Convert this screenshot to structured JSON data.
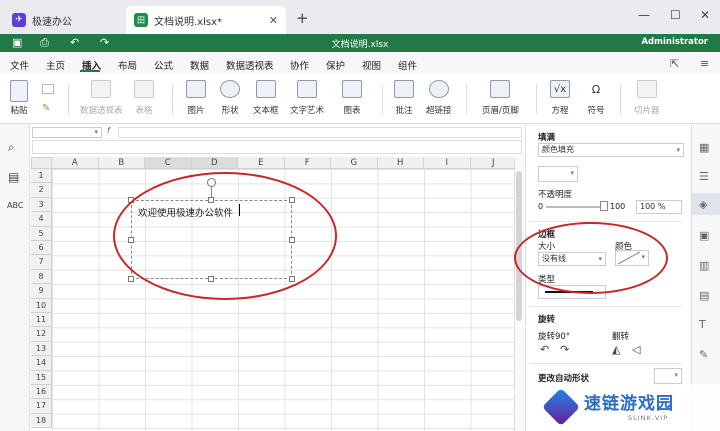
{
  "tabs": [
    {
      "label": "极速办公"
    },
    {
      "label": "文档说明.xlsx*"
    }
  ],
  "titlebar": {
    "title": "文档说明.xlsx",
    "user": "Administrator"
  },
  "menu": [
    "文件",
    "主页",
    "插入",
    "布局",
    "公式",
    "数据",
    "数据透视表",
    "协作",
    "保护",
    "视图",
    "组件"
  ],
  "ribbon": {
    "paste": "粘贴",
    "pivot": "数据透视表",
    "table": "表格",
    "image": "图片",
    "shape": "形状",
    "textbox": "文本框",
    "textart": "文字艺术",
    "chart": "图表",
    "comment": "批注",
    "hyperlink": "超链接",
    "header_footer": "页眉/页脚",
    "equation": "方程",
    "symbol": "符号",
    "slicer": "切片器"
  },
  "columns": [
    "A",
    "B",
    "C",
    "D",
    "E",
    "F",
    "G",
    "H",
    "I",
    "J"
  ],
  "rows": [
    "1",
    "2",
    "3",
    "4",
    "5",
    "6",
    "7",
    "8",
    "9",
    "10",
    "11",
    "12",
    "13",
    "14",
    "15",
    "16",
    "17",
    "18"
  ],
  "textbox": {
    "text": "欢迎使用极速办公软件"
  },
  "panel": {
    "fill_label": "填满",
    "fill_value": "颜色填充",
    "opacity_label": "不透明度",
    "opacity_min": "0",
    "opacity_max": "100",
    "opacity_value": "100 %",
    "border_label": "边框",
    "size_label": "大小",
    "size_value": "没有线",
    "color_label": "颜色",
    "type_label": "类型",
    "rotate_label": "旋转",
    "rotate_90": "旋转90°",
    "flip_label": "翻转",
    "change_shape": "更改自动形状"
  },
  "watermark": {
    "text": "速链游戏园",
    "sub": "SLINK.VIP"
  },
  "colors": {
    "brand_green": "#1f7a45",
    "annotation_red": "#c62828"
  }
}
